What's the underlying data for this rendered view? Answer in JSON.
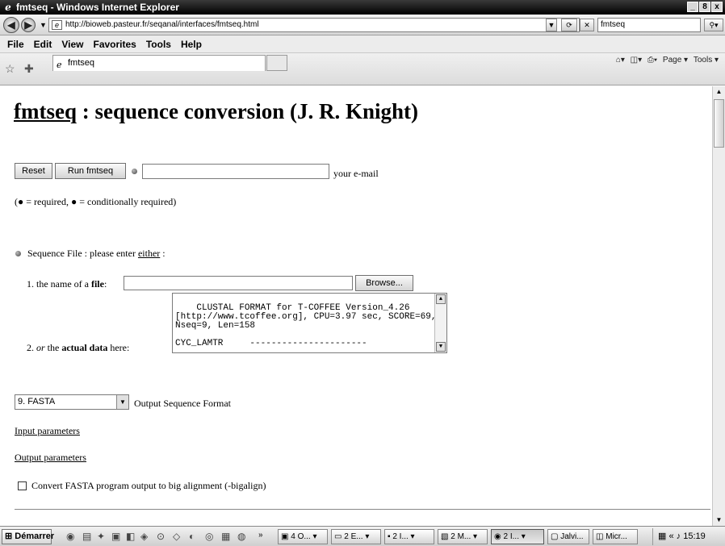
{
  "window": {
    "title": "fmtseq - Windows Internet Explorer",
    "controls": [
      "_",
      "8",
      "x"
    ]
  },
  "address": {
    "url": "http://bioweb.pasteur.fr/seqanal/interfaces/fmtseq.html",
    "search_text": "fmtseq"
  },
  "menu": [
    "File",
    "Edit",
    "View",
    "Favorites",
    "Tools",
    "Help"
  ],
  "tab": {
    "label": "fmtseq"
  },
  "commandbar": {
    "page": "Page ▾",
    "tools": "Tools ▾"
  },
  "page": {
    "title_link": "fmtseq",
    "title_rest": " : sequence conversion (J. R. Knight)",
    "reset_label": "Reset",
    "run_label": "Run fmtseq",
    "email_value": "",
    "email_label": "your e-mail",
    "legend": "(● = required, ● = conditionally required)",
    "seqfile_prefix": "Sequence File : please enter ",
    "seqfile_link": "either",
    "seqfile_suffix": " :",
    "item1_prefix": "1.  the name of a ",
    "item1_bold": "file",
    "item1_suffix": ":",
    "file_value": "",
    "browse_label": "Browse...",
    "item2_num": "2.  ",
    "item2_or": "or",
    "item2_mid": " the ",
    "item2_bold": "actual data",
    "item2_suffix": " here:",
    "textarea_text": "CLUSTAL FORMAT for T-COFFEE Version_4.26\n[http://www.tcoffee.org], CPU=3.97 sec, SCORE=69,\nNseq=9, Len=158\n\nCYC_LAMTR     ----------------------",
    "output_format_selected": "9. FASTA",
    "output_format_label": "Output Sequence Format",
    "input_params_link": "Input parameters",
    "output_params_link": "Output parameters",
    "bigalign_label": "Convert FASTA program output to big alignment (-bigalign)"
  },
  "taskbar": {
    "start": "Démarrer",
    "tasks": [
      "4 O...",
      "2 E...",
      "2 I...",
      "2 M...",
      "2 I...",
      "Jalvi...",
      "Micr..."
    ],
    "clock": "15:19"
  }
}
